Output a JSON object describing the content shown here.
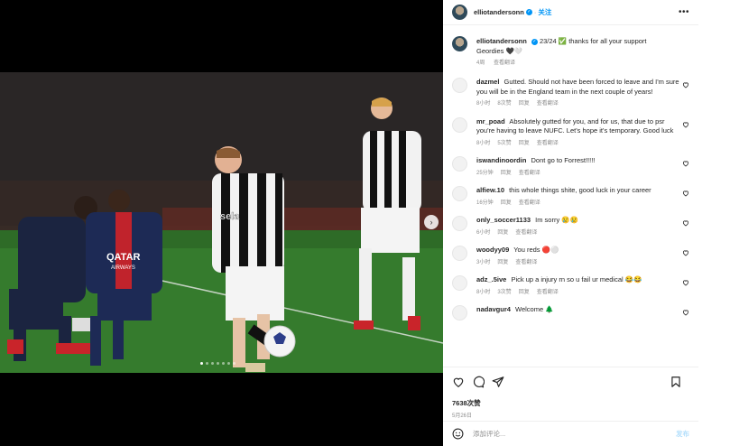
{
  "post": {
    "author": "elliotandersonn",
    "follow_label": "关注",
    "more_label": "•••",
    "media_dots": 7,
    "active_dot": 0
  },
  "caption": {
    "username": "elliotandersonn",
    "text": "23/24 ✅ thanks for all your support Geordies 🖤🤍",
    "time": "4周",
    "translate": "查看翻译"
  },
  "comments": [
    {
      "username": "dazmel",
      "text": "Gutted. Should not have been forced to leave and I'm sure you will be in the England team in the next couple of years!",
      "time": "8小时",
      "likes": "8次赞",
      "reply": "回复",
      "translate": "查看翻译"
    },
    {
      "username": "mr_poad",
      "text": "Absolutely gutted for you, and for us, that due to psr you're having to leave NUFC. Let's hope it's temporary. Good luck",
      "time": "8小时",
      "likes": "5次赞",
      "reply": "回复",
      "translate": "查看翻译"
    },
    {
      "username": "iswandinoordin",
      "text": "Dont go to Forrest!!!!!",
      "time": "25分钟",
      "likes": "",
      "reply": "回复",
      "translate": "查看翻译"
    },
    {
      "username": "alfiew.10",
      "text": "this whole things shite, good luck in your career",
      "time": "16分钟",
      "likes": "",
      "reply": "回复",
      "translate": "查看翻译"
    },
    {
      "username": "only_soccer1133",
      "text": "Im sorry 😢😢",
      "time": "6小时",
      "likes": "",
      "reply": "回复",
      "translate": "查看翻译"
    },
    {
      "username": "woodyy09",
      "text": "You reds 🔴⚪",
      "time": "3小时",
      "likes": "",
      "reply": "回复",
      "translate": "查看翻译"
    },
    {
      "username": "adz_.5ive",
      "text": "Pick up a injury rn so u fail ur medical 😂😂",
      "time": "8小时",
      "likes": "3次赞",
      "reply": "回复",
      "translate": "查看翻译"
    },
    {
      "username": "nadavgur4",
      "text": "Welcome 🌲",
      "time": "",
      "likes": "",
      "reply": "",
      "translate": ""
    }
  ],
  "stats": {
    "likes": "7638次赞",
    "date": "5月26日"
  },
  "composer": {
    "placeholder": "添加评论...",
    "post_label": "发布"
  },
  "colors": {
    "accent": "#0095f6",
    "muted": "#8e8e8e",
    "post_disabled": "#b3dffc"
  }
}
